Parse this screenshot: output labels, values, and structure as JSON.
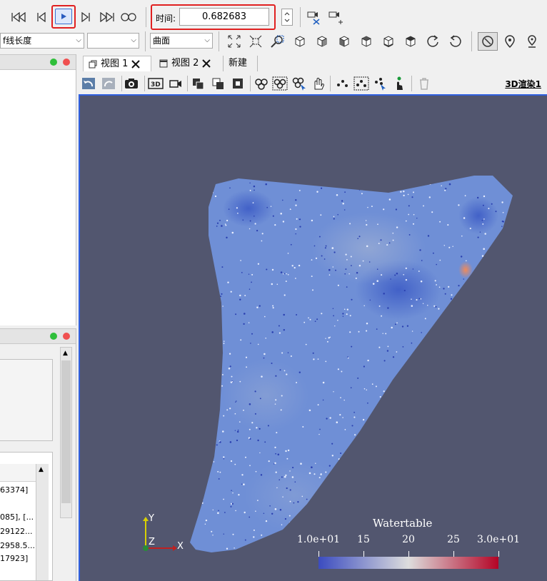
{
  "toolbar1": {
    "time_label": "时间:",
    "time_value": "0.682683"
  },
  "toolbar2": {
    "coloring_combo": "f线长度",
    "component_combo": "",
    "representation_combo": "曲面"
  },
  "view_tabs": {
    "tab1": "视图 1",
    "tab2": "视图 2",
    "new": "新建"
  },
  "render_label": "3D渲染1",
  "left_panel": {
    "rows": [
      "63374]",
      "085], [...",
      "29122...",
      "2958.5...",
      "17923]"
    ]
  },
  "axes": {
    "y": "Y",
    "z": "Z",
    "x": "X"
  },
  "colorbar": {
    "title": "Watertable",
    "ticks": [
      "1.0e+01",
      "15",
      "20",
      "25",
      "3.0e+01"
    ],
    "min": 10,
    "max": 30,
    "colors": [
      "#3b4cc0",
      "#dddddd",
      "#b40426"
    ]
  },
  "colors": {
    "viewport_bg": "#52566f",
    "highlight": "#e02020",
    "active_view_border": "#3060e0"
  }
}
